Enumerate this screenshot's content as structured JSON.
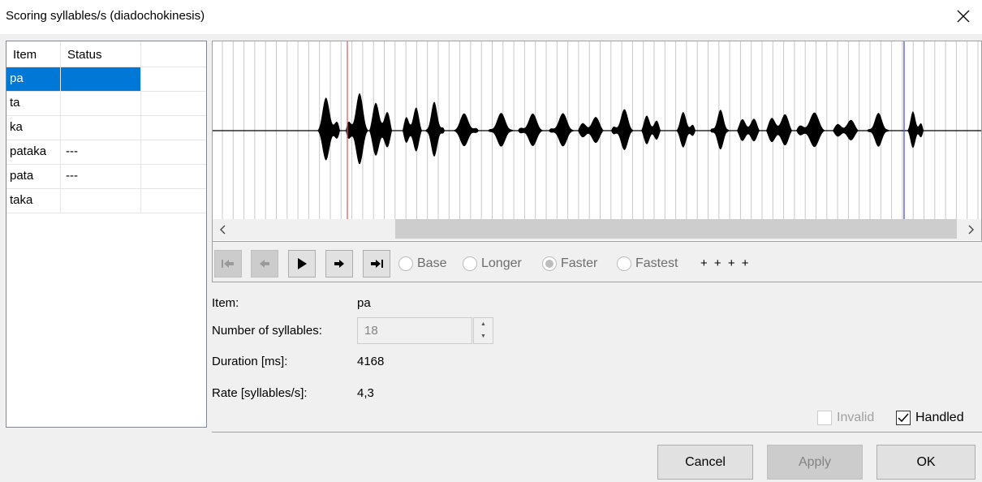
{
  "window": {
    "title": "Scoring syllables/s (diadochokinesis)"
  },
  "list": {
    "headers": {
      "item": "Item",
      "status": "Status"
    },
    "rows": [
      {
        "item": "pa",
        "status": "",
        "selected": true
      },
      {
        "item": "ta",
        "status": ""
      },
      {
        "item": "ka",
        "status": ""
      },
      {
        "item": "pataka",
        "status": "---"
      },
      {
        "item": "pata",
        "status": "---"
      },
      {
        "item": "taka",
        "status": ""
      }
    ]
  },
  "toolbar": {
    "radios": [
      {
        "label": "Base",
        "checked": false
      },
      {
        "label": "Longer",
        "checked": false
      },
      {
        "label": "Faster",
        "checked": true
      },
      {
        "label": "Fastest",
        "checked": false
      }
    ],
    "markers": "+ + + +"
  },
  "info": {
    "item_label": "Item:",
    "item_value": "pa",
    "syllables_label": "Number of syllables:",
    "syllables_value": "18",
    "duration_label": "Duration [ms]:",
    "duration_value": "4168",
    "rate_label": "Rate [syllables/s]:",
    "rate_value": "4,3"
  },
  "checkboxes": {
    "invalid_label": "Invalid",
    "invalid_checked": false,
    "handled_label": "Handled",
    "handled_checked": true
  },
  "buttons": {
    "cancel": "Cancel",
    "apply": "Apply",
    "ok": "OK"
  },
  "colors": {
    "selection": "#0078d7",
    "start_marker": "#e06060",
    "end_marker": "#5050e0"
  }
}
